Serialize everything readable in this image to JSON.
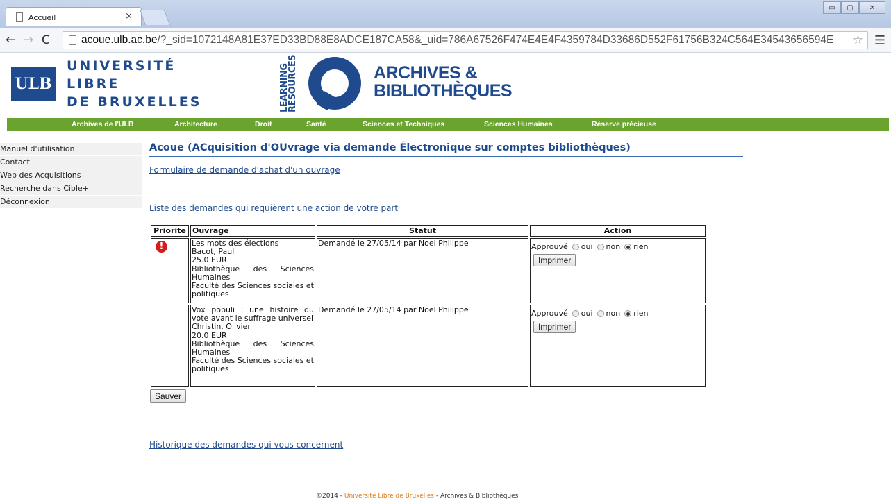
{
  "browser": {
    "tab_title": "Accueil",
    "tab_close": "×",
    "url_host": "acoue.ulb.ac.be",
    "url_path": "/?_sid=1072148A81E37ED33BD88E8ADCE187CA58&_uid=786A67526F474E4E4F4359784D33686D552F61756B324C564E34543656594E",
    "window_buttons": [
      "▭",
      "▢",
      "✕"
    ]
  },
  "header": {
    "ulb_logo": "ULB",
    "ulb_name": [
      "UNIVERSITÉ",
      "LIBRE",
      "DE BRUXELLES"
    ],
    "learning_resources": [
      "LEARNING",
      "RESOURCES"
    ],
    "ab_name": [
      "ARCHIVES &",
      "BIBLIOTHÈQUES"
    ],
    "brand_color": "#1f4b8e"
  },
  "nav": {
    "color": "#6aa42f",
    "items": [
      "Archives de l'ULB",
      "Architecture",
      "Droit",
      "Santé",
      "Sciences et Techniques",
      "Sciences Humaines",
      "Réserve précieuse"
    ]
  },
  "sidebar": {
    "items": [
      "Manuel d'utilisation",
      "Contact",
      "Web des Acquisitions",
      "Recherche dans Cible+",
      "Déconnexion"
    ]
  },
  "main": {
    "title": "Acoue (ACquisition d'OUvrage via demande Électronique sur comptes bibliothèques)",
    "form_link": "Formulaire de demande d'achat d'un ouvrage",
    "list_link": "Liste des demandes qui requièrent une action de votre part",
    "history_link": "Historique des demandes qui vous concernent",
    "save_label": "Sauver"
  },
  "table": {
    "headers": [
      "Priorite",
      "Ouvrage",
      "Statut",
      "Action"
    ],
    "approve_label": "Approuvé",
    "options": [
      "oui",
      "non",
      "rien"
    ],
    "print_label": "Imprimer",
    "rows": [
      {
        "priority_icon": "!",
        "ouvrage": [
          "Les mots des élections",
          "Bacot, Paul",
          "25.0 EUR",
          "Bibliothèque des Sciences Humaines",
          "Faculté des Sciences sociales et politiques"
        ],
        "statut": "Demandé le 27/05/14 par Noel Philippe",
        "selected": "rien"
      },
      {
        "priority_icon": "",
        "ouvrage": [
          "Vox populi : une histoire du vote avant le suffrage universel",
          "Christin, Olivier",
          "20.0 EUR",
          "Bibliothèque des Sciences Humaines",
          "Faculté des Sciences sociales et politiques"
        ],
        "statut": "Demandé le 27/05/14 par Noel Philippe",
        "selected": "rien"
      }
    ]
  },
  "footer": {
    "prefix": "©2014 - ",
    "ulb_link": "Université Libre de Bruxelles",
    "suffix": " - Archives & Bibliothèques"
  }
}
